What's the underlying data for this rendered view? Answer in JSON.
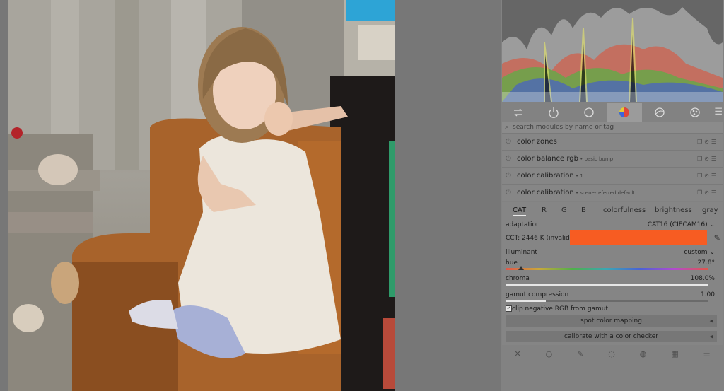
{
  "histogram": {
    "label": "histogram"
  },
  "module_tabs": [
    {
      "icon": "quick-access-icon"
    },
    {
      "icon": "active-modules-icon"
    },
    {
      "icon": "base-modules-icon"
    },
    {
      "icon": "color-modules-icon",
      "active": true
    },
    {
      "icon": "correct-modules-icon"
    },
    {
      "icon": "effect-modules-icon"
    }
  ],
  "search": {
    "placeholder": "search modules by name or tag"
  },
  "modules": [
    {
      "name": "color zones",
      "instance": ""
    },
    {
      "name": "color balance rgb",
      "instance": " • basic bump"
    },
    {
      "name": "color calibration",
      "instance": " • 1"
    },
    {
      "name": "color calibration",
      "instance": " • scene-referred default"
    }
  ],
  "calibration": {
    "tabs": [
      "CAT",
      "R",
      "G",
      "B",
      "colorfulness",
      "brightness",
      "gray"
    ],
    "active_tab": "CAT",
    "adaptation_label": "adaptation",
    "adaptation_value": "CAT16 (CIECAM16)",
    "cct_label": "CCT: 2446 K (invalid)",
    "cct_color": "#f75c22",
    "illuminant_label": "illuminant",
    "illuminant_value": "custom",
    "hue_label": "hue",
    "hue_value": "27.8°",
    "hue_fraction": 0.077,
    "chroma_label": "chroma",
    "chroma_value": "108.0%",
    "chroma_fraction": 1.0,
    "gamut_label": "gamut compression",
    "gamut_value": "1.00",
    "gamut_fraction": 0.2,
    "clip_label": "clip negative RGB from gamut",
    "clip_checked": true,
    "spot_button": "spot color mapping",
    "checker_button": "calibrate with a color checker"
  },
  "bottom_icons": [
    "reset-icon",
    "presets-circle-icon",
    "pencil-icon",
    "drawn-mask-icon",
    "parametric-mask-icon",
    "raster-mask-icon",
    "menu-icon"
  ]
}
